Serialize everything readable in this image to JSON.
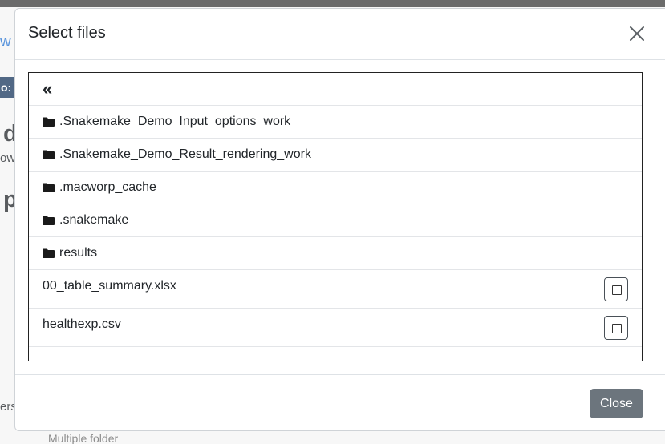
{
  "background": {
    "link_fragment": "w",
    "badge_fragment": "o:",
    "heading_fragment_1": "d",
    "text_fragment_left": "ow",
    "text_fragment_right": "w",
    "heading_fragment_2": "p",
    "text_fragment_bottom": "ers",
    "text_fragment_multiple": "Multiple folder"
  },
  "modal": {
    "title": "Select files",
    "back_label": "«",
    "folders": [
      ".Snakemake_Demo_Input_options_work",
      ".Snakemake_Demo_Result_rendering_work",
      ".macworp_cache",
      ".snakemake",
      "results"
    ],
    "files": [
      {
        "name": "00_table_summary.xlsx",
        "selected": false
      },
      {
        "name": "healthexp.csv",
        "selected": false
      }
    ],
    "close_button_label": "Close"
  },
  "colors": {
    "close_button": "#6c757d",
    "badge": "#17365d",
    "link": "#1f6fd1"
  }
}
